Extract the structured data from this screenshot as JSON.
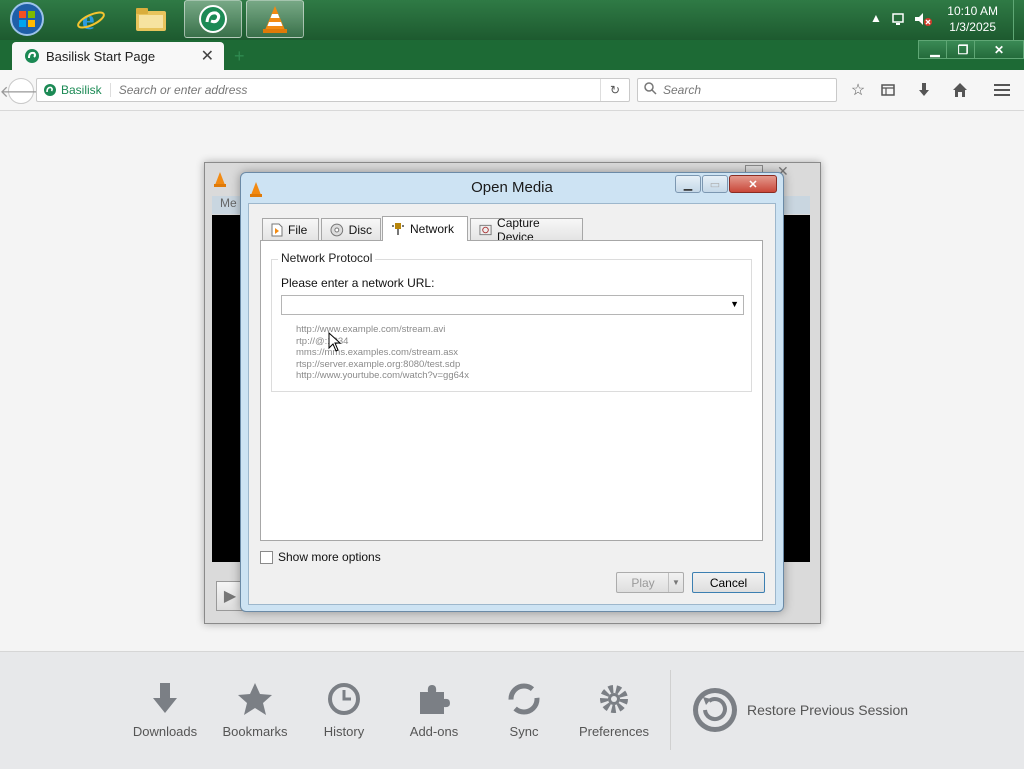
{
  "taskbar": {
    "clock_time": "10:10 AM",
    "clock_date": "1/3/2025"
  },
  "browser": {
    "tab_title": "Basilisk Start Page",
    "identity_label": "Basilisk",
    "address_placeholder": "Search or enter address",
    "search_placeholder": "Search",
    "new_tab_glyph": "+"
  },
  "vlc_window": {
    "menu_partial": "Me"
  },
  "open_media": {
    "title": "Open Media",
    "tabs": [
      {
        "label": "File"
      },
      {
        "label": "Disc"
      },
      {
        "label": "Network"
      },
      {
        "label": "Capture Device"
      }
    ],
    "group_title": "Network Protocol",
    "url_prompt": "Please enter a network URL:",
    "url_value": "",
    "examples": [
      "http://www.example.com/stream.avi",
      "rtp://@:1234",
      "mms://mms.examples.com/stream.asx",
      "rtsp://server.example.org:8080/test.sdp",
      "http://www.yourtube.com/watch?v=gg64x"
    ],
    "show_more_options": "Show more options",
    "play_label": "Play",
    "cancel_label": "Cancel"
  },
  "launcher": {
    "items": [
      {
        "label": "Downloads",
        "icon": "download-icon"
      },
      {
        "label": "Bookmarks",
        "icon": "star-icon"
      },
      {
        "label": "History",
        "icon": "clock-icon"
      },
      {
        "label": "Add-ons",
        "icon": "puzzle-icon"
      },
      {
        "label": "Sync",
        "icon": "sync-icon"
      },
      {
        "label": "Preferences",
        "icon": "gear-icon"
      }
    ],
    "restore_label": "Restore Previous Session"
  },
  "colors": {
    "taskbar": "#2f7a45",
    "browser_chrome": "#1d6a35",
    "dialog_frame": "#cde3f3",
    "close_button": "#c9483a"
  }
}
